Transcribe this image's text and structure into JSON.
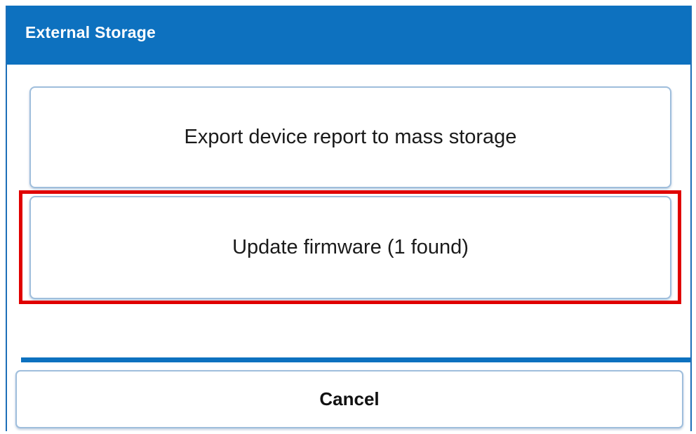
{
  "dialog": {
    "title": "External Storage",
    "options": [
      {
        "label": "Export device report to mass storage",
        "highlighted": false
      },
      {
        "label": "Update firmware (1 found)",
        "highlighted": true
      }
    ],
    "cancel_label": "Cancel"
  },
  "colors": {
    "accent": "#0d71bf",
    "button_border": "#9fbedc",
    "highlight": "#e00000"
  }
}
